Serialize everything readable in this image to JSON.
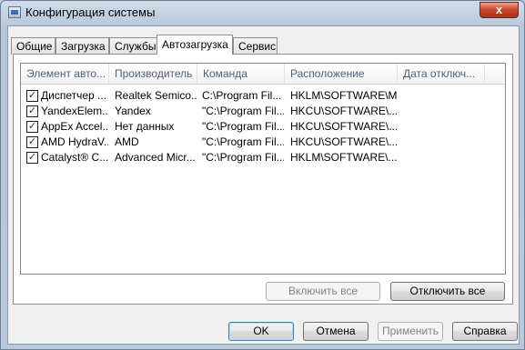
{
  "window": {
    "title": "Конфигурация системы",
    "close_glyph": "x"
  },
  "tabs": [
    {
      "label": "Общие"
    },
    {
      "label": "Загрузка"
    },
    {
      "label": "Службы"
    },
    {
      "label": "Автозагрузка",
      "active": true
    },
    {
      "label": "Сервис"
    }
  ],
  "startup_table": {
    "columns": [
      "Элемент авто...",
      "Производитель",
      "Команда",
      "Расположение",
      "Дата отключ..."
    ],
    "rows": [
      {
        "checked": true,
        "item": "Диспетчер ...",
        "manufacturer": "Realtek Semico...",
        "command": "C:\\Program Fil...",
        "location": "HKLM\\SOFTWARE\\M...",
        "disabled_date": ""
      },
      {
        "checked": true,
        "item": "YandexElem...",
        "manufacturer": "Yandex",
        "command": "\"C:\\Program Fil...",
        "location": "HKCU\\SOFTWARE\\...",
        "disabled_date": ""
      },
      {
        "checked": true,
        "item": "AppEx Accel...",
        "manufacturer": "Нет данных",
        "command": "\"C:\\Program Fil...",
        "location": "HKCU\\SOFTWARE\\...",
        "disabled_date": ""
      },
      {
        "checked": true,
        "item": "AMD HydraV...",
        "manufacturer": "AMD",
        "command": "\"C:\\Program Fil...",
        "location": "HKCU\\SOFTWARE\\...",
        "disabled_date": ""
      },
      {
        "checked": true,
        "item": "Catalyst® C...",
        "manufacturer": "Advanced Micr...",
        "command": "\"C:\\Program Fil...",
        "location": "HKLM\\SOFTWARE\\...",
        "disabled_date": ""
      }
    ]
  },
  "actions": {
    "enable_all": "Включить все",
    "disable_all": "Отключить все"
  },
  "footer": {
    "ok": "OK",
    "cancel": "Отмена",
    "apply": "Применить",
    "help": "Справка"
  },
  "check_glyph": "✓"
}
